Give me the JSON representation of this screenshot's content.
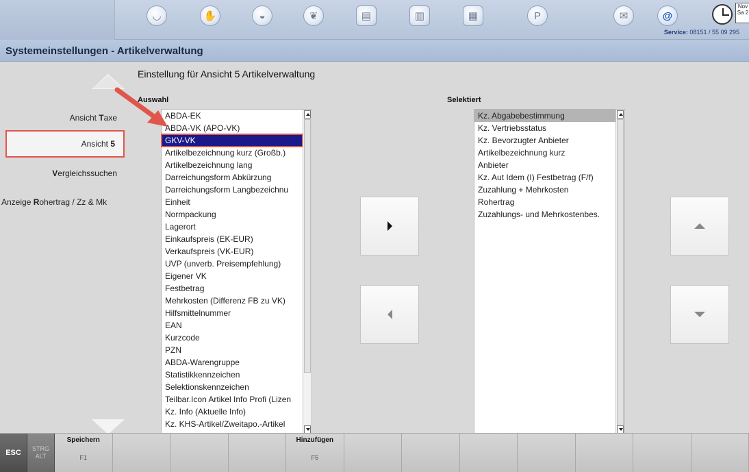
{
  "header": {
    "service_label": "Service:",
    "service_number": "08151 / 55 09 295",
    "date_month": "Nov",
    "date_day": "Sa 2"
  },
  "title": "Systemeinstellungen - Artikelverwaltung",
  "sidebar": {
    "items": [
      {
        "pre": "Ansicht ",
        "key": "T",
        "post": "axe"
      },
      {
        "pre": "Ansicht ",
        "key": "5",
        "post": ""
      },
      {
        "pre": "",
        "key": "V",
        "post": "ergleichssuchen"
      },
      {
        "pre": "Anzeige ",
        "key": "R",
        "post": "ohertrag / Zz & Mk"
      }
    ]
  },
  "main": {
    "section_title": "Einstellung für Ansicht 5 Artikelverwaltung",
    "auswahl_label": "Auswahl",
    "selektiert_label": "Selektiert",
    "auswahl_items": [
      "ABDA-EK",
      "ABDA-VK (APO-VK)",
      "GKV-VK",
      "Artikelbezeichnung kurz (Großb.)",
      "Artikelbezeichnung lang",
      "Darreichungsform Abkürzung",
      "Darreichungsform Langbezeichnu",
      "Einheit",
      "Normpackung",
      "Lagerort",
      "Einkaufspreis (EK-EUR)",
      "Verkaufspreis (VK-EUR)",
      "UVP (unverb. Preisempfehlung)",
      "Eigener VK",
      "Festbetrag",
      "Mehrkosten (Differenz FB zu VK)",
      "Hilfsmittelnummer",
      "EAN",
      "Kurzcode",
      "PZN",
      "ABDA-Warengruppe",
      "Statistikkennzeichen",
      "Selektionskennzeichen",
      "Teilbar.Icon Artikel Info Profi (Lizen",
      "Kz. Info (Aktuelle Info)",
      "Kz. KHS-Artikel/Zweitapo.-Artikel"
    ],
    "auswahl_selected_index": 2,
    "selektiert_items": [
      "Kz. Abgabebestimmung",
      "Kz. Vertriebsstatus",
      "Kz. Bevorzugter Anbieter",
      "Artikelbezeichnung kurz",
      "Anbieter",
      "Kz. Aut Idem (I) Festbetrag (F/f)",
      "Zuzahlung + Mehrkosten",
      "Rohertrag",
      "Zuzahlungs- und Mehrkostenbes."
    ],
    "selektiert_selected_index": 0
  },
  "function_bar": {
    "esc": "ESC",
    "mod_top": "STRG",
    "mod_bottom": "ALT",
    "keys": [
      {
        "label": "Speichern",
        "num": "F1"
      },
      {
        "label": "",
        "num": ""
      },
      {
        "label": "",
        "num": ""
      },
      {
        "label": "",
        "num": ""
      },
      {
        "label": "Hinzufügen",
        "num": "F5"
      },
      {
        "label": "",
        "num": ""
      },
      {
        "label": "",
        "num": ""
      },
      {
        "label": "",
        "num": ""
      },
      {
        "label": "",
        "num": ""
      },
      {
        "label": "",
        "num": ""
      },
      {
        "label": "",
        "num": ""
      },
      {
        "label": "",
        "num": ""
      }
    ]
  },
  "icons": [
    "mortar-icon",
    "handshake-icon",
    "shopping-bag-icon",
    "tooth-icon",
    "printer-icon",
    "books-icon",
    "calculator-icon",
    "p-logo-icon",
    "mail-icon",
    "at-icon",
    "clock-icon"
  ],
  "colors": {
    "selection": "#1a1a8a",
    "highlight_box": "#e0564b",
    "header": "#b8c9e0"
  }
}
